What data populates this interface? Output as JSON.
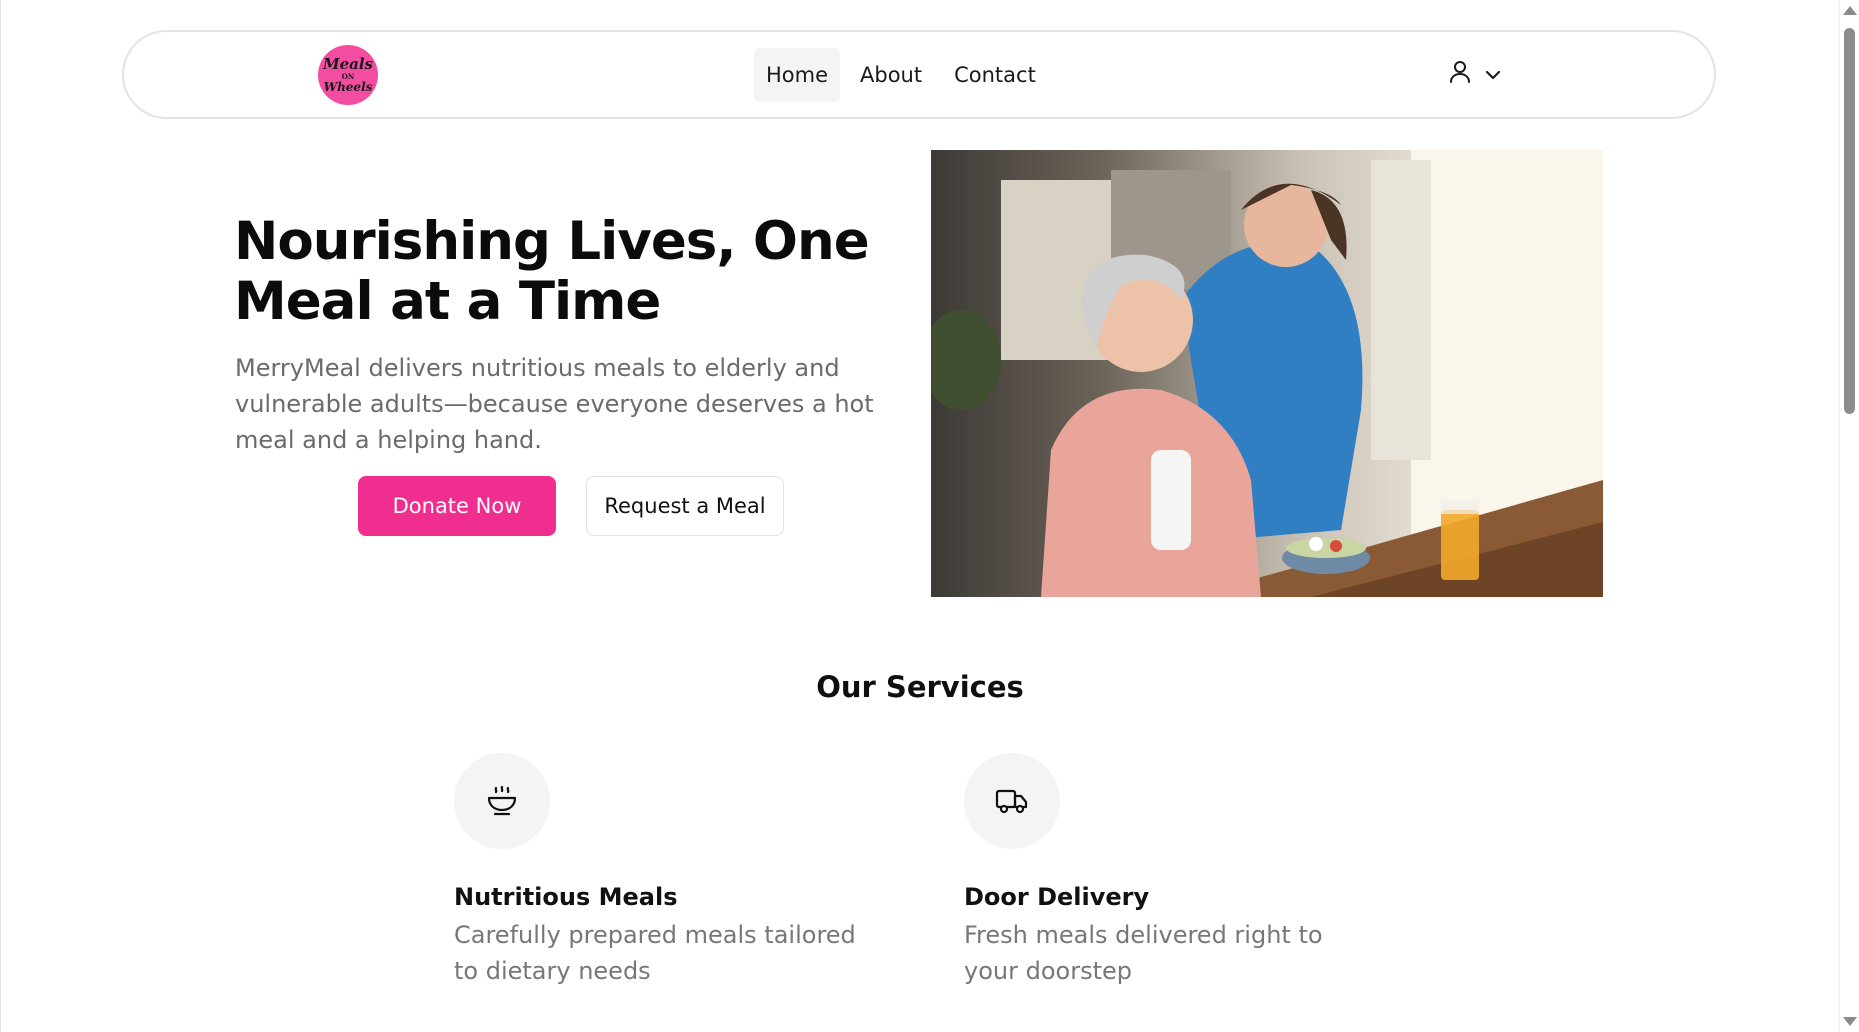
{
  "nav": {
    "logo": {
      "line1": "Meals",
      "line2": "ON",
      "line3": "Wheels"
    },
    "links": [
      {
        "label": "Home",
        "active": true
      },
      {
        "label": "About",
        "active": false
      },
      {
        "label": "Contact",
        "active": false
      }
    ],
    "user_icon": "user-icon",
    "dropdown_icon": "chevron-down-icon"
  },
  "hero": {
    "title": "Nourishing Lives, One Meal at a Time",
    "description": "MerryMeal delivers nutritious meals to elderly and vulnerable adults—because everyone deserves a hot meal and a helping hand.",
    "primary_button": "Donate Now",
    "secondary_button": "Request a Meal"
  },
  "services": {
    "title": "Our Services",
    "items": [
      {
        "icon": "bowl-icon",
        "title": "Nutritious Meals",
        "description": "Carefully prepared meals tailored to dietary needs"
      },
      {
        "icon": "truck-icon",
        "title": "Door Delivery",
        "description": "Fresh meals delivered right to your doorstep"
      }
    ]
  },
  "colors": {
    "accent": "#f02e8f",
    "logo_bg": "#f24da1",
    "text_muted": "#6b6b6b",
    "icon_circle_bg": "#f4f4f5"
  }
}
